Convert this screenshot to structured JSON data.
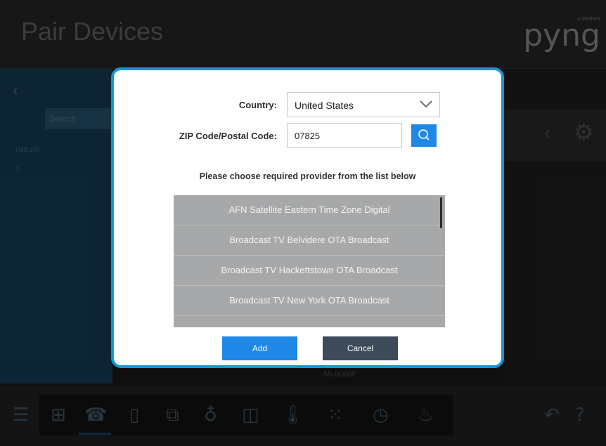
{
  "header": {
    "title": "Pair Devices",
    "brand_small": "crestron",
    "brand_logo": "pyng"
  },
  "sidebar": {
    "back_icon": "chevron-left-icon",
    "search_placeholder": "Search",
    "item_1": "H38-100",
    "item_2": "0"
  },
  "right_panel": {
    "back_icon": "chevron-left-icon",
    "settings_icon": "gear-icon"
  },
  "behind_dialog": {
    "footer_text": "55-0000F"
  },
  "bottom_bar": {
    "icons": [
      "menu-icon",
      "add-device-icon",
      "remote-icon",
      "door-icon",
      "scene-icon",
      "lightbulb-icon",
      "shade-icon",
      "thermometer-icon",
      "keypad-icon",
      "clock-icon",
      "sensor-icon",
      "undo-icon",
      "help-icon"
    ]
  },
  "dialog": {
    "country_label": "Country:",
    "country_value": "United States",
    "zip_label": "ZIP Code/Postal Code:",
    "zip_value": "07825",
    "search_icon": "search-icon",
    "instruction": "Please choose required provider from the list below",
    "providers": [
      "AFN Satellite Eastern Time Zone Digital",
      "Broadcast TV Belvidere OTA Broadcast",
      "Broadcast TV Hackettstown OTA Broadcast",
      "Broadcast TV New York OTA Broadcast"
    ],
    "add_label": "Add",
    "cancel_label": "Cancel"
  },
  "colors": {
    "accent_blue": "#1f87e5",
    "dialog_border": "#1795d4",
    "list_bg": "#a7a8a9",
    "cancel_bg": "#3c4a5a"
  }
}
